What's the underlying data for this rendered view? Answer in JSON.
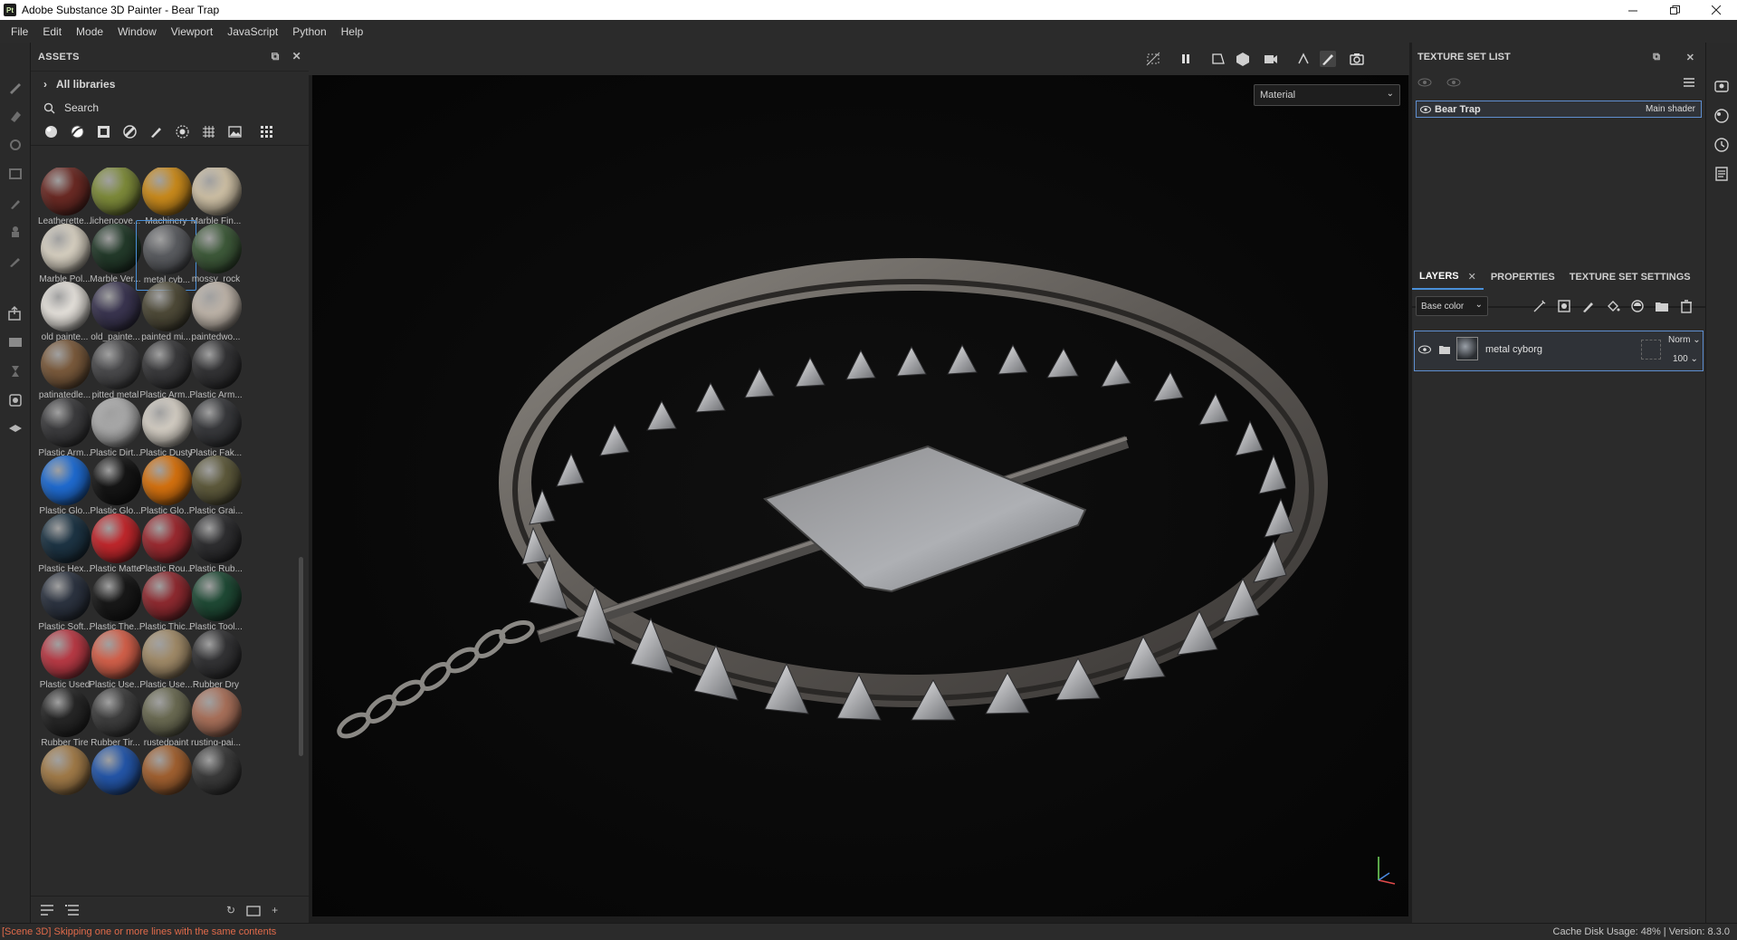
{
  "window": {
    "app_badge": "Pt",
    "title": "Adobe Substance 3D Painter - Bear Trap"
  },
  "menu": [
    "File",
    "Edit",
    "Mode",
    "Window",
    "Viewport",
    "JavaScript",
    "Python",
    "Help"
  ],
  "assets": {
    "header": "ASSETS",
    "libraries": "All libraries",
    "search_placeholder": "Search",
    "materials": [
      {
        "label": "Leatherette...",
        "color": "#6a2a24"
      },
      {
        "label": "lichencove...",
        "color": "#7d8a3a"
      },
      {
        "label": "Machinery",
        "color": "#c98a1c"
      },
      {
        "label": "Marble Fin...",
        "color": "#cdbfa4"
      },
      {
        "label": "Marble Pol...",
        "color": "#d6cfc0"
      },
      {
        "label": "Marble Ver...",
        "color": "#233a2a"
      },
      {
        "label": "metal cyb...",
        "color": "#5a5c60",
        "selected": true
      },
      {
        "label": "mossy_rock",
        "color": "#3e5a3a"
      },
      {
        "label": "old painte...",
        "color": "#e4e0da"
      },
      {
        "label": "old_painte...",
        "color": "#3a3550"
      },
      {
        "label": "painted mi...",
        "color": "#4e4a38"
      },
      {
        "label": "paintedwo...",
        "color": "#bdb3a8"
      },
      {
        "label": "patinatedle...",
        "color": "#7a5a3c"
      },
      {
        "label": "pitted metal",
        "color": "#4a4a4c"
      },
      {
        "label": "Plastic Arm...",
        "color": "#3a3a3c"
      },
      {
        "label": "Plastic Arm...",
        "color": "#333335"
      },
      {
        "label": "Plastic Arm...",
        "color": "#3c3c3e"
      },
      {
        "label": "Plastic Dirt...",
        "color": "#a8a8a8"
      },
      {
        "label": "Plastic Dusty",
        "color": "#d2ccc2"
      },
      {
        "label": "Plastic Fak...",
        "color": "#38393c"
      },
      {
        "label": "Plastic Glo...",
        "color": "#1f6bd0"
      },
      {
        "label": "Plastic Glo...",
        "color": "#151515"
      },
      {
        "label": "Plastic Glo...",
        "color": "#d4710f"
      },
      {
        "label": "Plastic Grai...",
        "color": "#5e5a3c"
      },
      {
        "label": "Plastic Hex...",
        "color": "#1d3444"
      },
      {
        "label": "Plastic Matte",
        "color": "#c0272c"
      },
      {
        "label": "Plastic Rou...",
        "color": "#9a2a30"
      },
      {
        "label": "Plastic Rub...",
        "color": "#2e2e30"
      },
      {
        "label": "Plastic Soft...",
        "color": "#2c3340"
      },
      {
        "label": "Plastic The...",
        "color": "#181818"
      },
      {
        "label": "Plastic Thic...",
        "color": "#8e2a30"
      },
      {
        "label": "Plastic Tool...",
        "color": "#1f4a35"
      },
      {
        "label": "Plastic Used",
        "color": "#b83a45"
      },
      {
        "label": "Plastic Use...",
        "color": "#d2604a"
      },
      {
        "label": "Plastic Use...",
        "color": "#a08a68"
      },
      {
        "label": "Rubber Dry",
        "color": "#333335"
      },
      {
        "label": "Rubber Tire",
        "color": "#262626"
      },
      {
        "label": "Rubber Tir...",
        "color": "#3e3e3e"
      },
      {
        "label": "rustedpaint",
        "color": "#6a6a52"
      },
      {
        "label": "rusting-pai...",
        "color": "#a8705a"
      },
      {
        "label": "",
        "color": "#a07a48"
      },
      {
        "label": "",
        "color": "#2456a8"
      },
      {
        "label": "",
        "color": "#a06030"
      },
      {
        "label": "",
        "color": "#3a3a3a"
      }
    ]
  },
  "viewport": {
    "display_mode": "Material"
  },
  "texture_set_list": {
    "header": "TEXTURE SET LIST",
    "item_name": "Bear Trap",
    "item_shader": "Main shader"
  },
  "layers": {
    "tabs": [
      "LAYERS",
      "PROPERTIES",
      "TEXTURE SET SETTINGS"
    ],
    "channel": "Base color",
    "layer_name": "metal cyborg",
    "blend_mode": "Norm",
    "opacity": "100"
  },
  "status": {
    "message": "[Scene 3D] Skipping one or more lines with the same contents",
    "right": "Cache Disk Usage:   48% | Version: 8.3.0"
  }
}
